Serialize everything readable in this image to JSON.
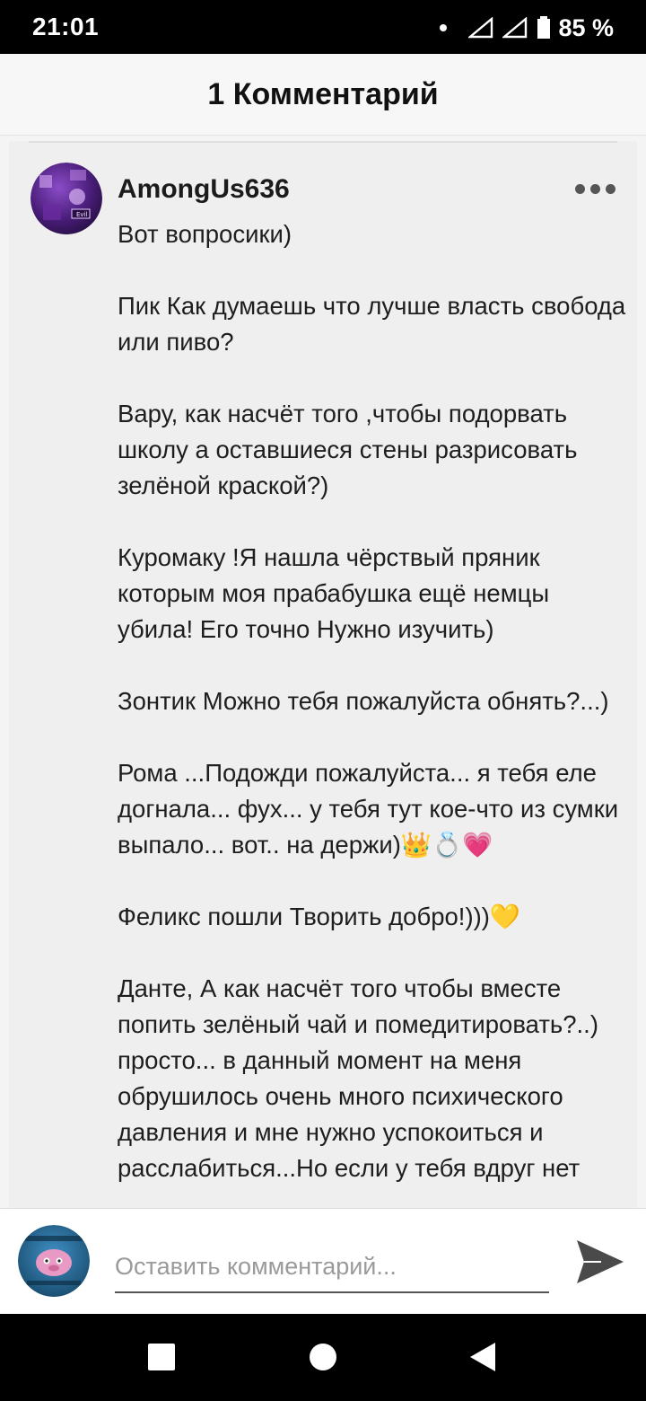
{
  "status_bar": {
    "time": "21:01",
    "battery_percent": "85 %",
    "battery_level": 0.85
  },
  "header": {
    "title": "1 Комментарий"
  },
  "comment": {
    "author": "AmongUs636",
    "avatar_label": "Evil",
    "paragraphs": [
      "Вот вопросики)",
      "Пик Как думаешь что лучше власть свобода или пиво?",
      "Вару, как насчёт того ,чтобы подорвать школу а оставшиеся стены разрисовать зелёной краской?)",
      "Куромаку !Я нашла чёрствый пряник которым моя прабабушка ещё немцы убила! Его точно Нужно изучить)",
      "Зонтик Можно тебя пожалуйста обнять?...)",
      "Рома ...Подожди пожалуйста... я тебя еле догнала... фух... у тебя тут кое-что из сумки выпало... вот.. на держи)👑💍💗",
      "Феликс пошли Творить добро!)))💛",
      "Данте, А как насчёт того чтобы вместе попить зелёный чай и помедитировать?..) просто... в данный момент на меня обрушилось очень много психического давления и мне нужно успокоиться и расслабиться...Но если у тебя вдруг нет"
    ]
  },
  "input": {
    "placeholder": "Оставить комментарий..."
  },
  "colors": {
    "status_bar_bg": "#000000",
    "header_bg": "#f7f7f7",
    "card_bg": "#efefef",
    "text": "#1e1e1e",
    "send_icon": "#4a4a4a"
  },
  "icons": {
    "more": "more-dots-icon",
    "send": "send-icon",
    "nav_recents": "square-recents-icon",
    "nav_home": "circle-home-icon",
    "nav_back": "triangle-back-icon",
    "signal": "signal-icon",
    "battery": "battery-icon"
  }
}
